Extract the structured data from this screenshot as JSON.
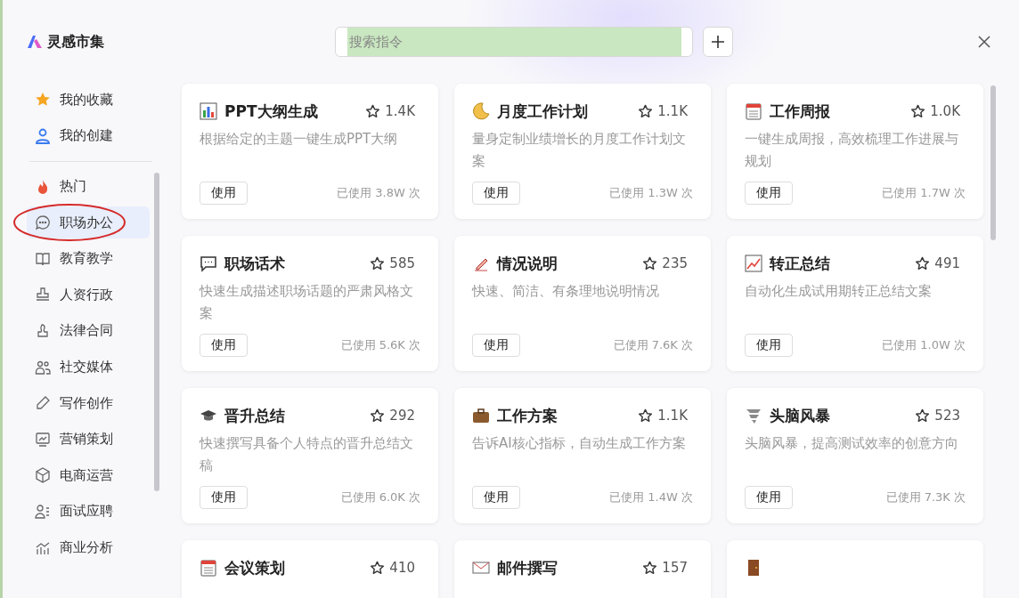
{
  "app": {
    "name": "灵感市集"
  },
  "search": {
    "placeholder": "搜索指令"
  },
  "sidebar": {
    "pinned": [
      {
        "label": "我的收藏",
        "kind": "star",
        "selected": false
      },
      {
        "label": "我的创建",
        "kind": "person",
        "selected": false
      }
    ],
    "categories": [
      {
        "label": "热门",
        "kind": "fire",
        "selected": false,
        "annotated": false
      },
      {
        "label": "职场办公",
        "kind": "chat",
        "selected": true,
        "annotated": true
      },
      {
        "label": "教育教学",
        "kind": "book",
        "selected": false,
        "annotated": false
      },
      {
        "label": "人资行政",
        "kind": "stamp",
        "selected": false,
        "annotated": false
      },
      {
        "label": "法律合同",
        "kind": "seal",
        "selected": false,
        "annotated": false
      },
      {
        "label": "社交媒体",
        "kind": "people",
        "selected": false,
        "annotated": false
      },
      {
        "label": "写作创作",
        "kind": "pencil",
        "selected": false,
        "annotated": false
      },
      {
        "label": "营销策划",
        "kind": "monitor",
        "selected": false,
        "annotated": false
      },
      {
        "label": "电商运营",
        "kind": "box",
        "selected": false,
        "annotated": false
      },
      {
        "label": "面试应聘",
        "kind": "idlist",
        "selected": false,
        "annotated": false
      },
      {
        "label": "商业分析",
        "kind": "bars",
        "selected": false,
        "annotated": false
      }
    ]
  },
  "cards": [
    {
      "kind": "chart",
      "title": "PPT大纲生成",
      "favorites": "1.4K",
      "description": "根据给定的主题一键生成PPT大纲",
      "button": "使用",
      "usage": "已使用 3.8W 次"
    },
    {
      "kind": "moon",
      "title": "月度工作计划",
      "favorites": "1.1K",
      "description": "量身定制业绩增长的月度工作计划文案",
      "button": "使用",
      "usage": "已使用 1.3W 次"
    },
    {
      "kind": "calendar",
      "title": "工作周报",
      "favorites": "1.0K",
      "description": "一键生成周报，高效梳理工作进展与规划",
      "button": "使用",
      "usage": "已使用 1.7W 次"
    },
    {
      "kind": "speech",
      "title": "职场话术",
      "favorites": "585",
      "description": "快速生成描述职场话题的严肃风格文案",
      "button": "使用",
      "usage": "已使用 5.6K 次"
    },
    {
      "kind": "pencil",
      "title": "情况说明",
      "favorites": "235",
      "description": "快速、简洁、有条理地说明情况",
      "button": "使用",
      "usage": "已使用 7.6K 次"
    },
    {
      "kind": "trend",
      "title": "转正总结",
      "favorites": "491",
      "description": "自动化生成试用期转正总结文案",
      "button": "使用",
      "usage": "已使用 1.0W 次"
    },
    {
      "kind": "cap",
      "title": "晋升总结",
      "favorites": "292",
      "description": "快速撰写具备个人特点的晋升总结文稿",
      "button": "使用",
      "usage": "已使用 6.0K 次"
    },
    {
      "kind": "briefcase",
      "title": "工作方案",
      "favorites": "1.1K",
      "description": "告诉AI核心指标，自动生成工作方案",
      "button": "使用",
      "usage": "已使用 1.4W 次"
    },
    {
      "kind": "tornado",
      "title": "头脑风暴",
      "favorites": "523",
      "description": "头脑风暴，提高测试效率的创意方向",
      "button": "使用",
      "usage": "已使用 7.3K 次"
    },
    {
      "kind": "calendar",
      "title": "会议策划",
      "favorites": "410"
    },
    {
      "kind": "mail",
      "title": "邮件撰写",
      "favorites": "157"
    },
    {
      "kind": "door"
    }
  ]
}
